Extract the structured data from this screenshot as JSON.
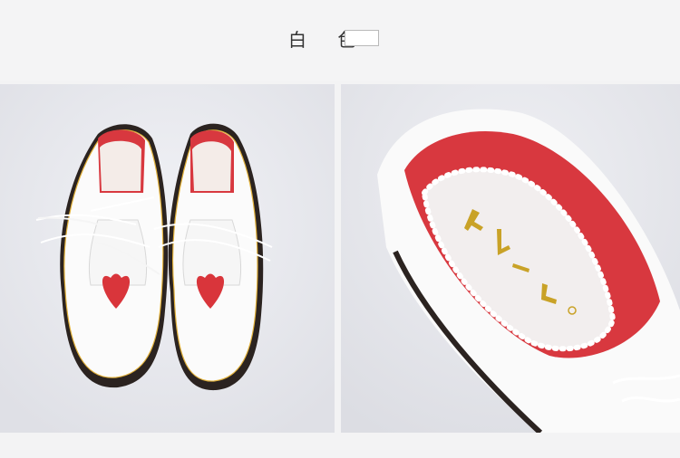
{
  "product": {
    "color_label": "白 色",
    "swatch_color": "#ffffff"
  },
  "photos": [
    {
      "subject": "shoe-pair-top-view",
      "icon": "shoe-pair-image"
    },
    {
      "subject": "shoe-insole-closeup",
      "icon": "insole-image",
      "insole_text": "十九一鹿"
    }
  ],
  "colors": {
    "shoe_white": "#fbfbfb",
    "heart_red": "#d9353b",
    "lining_red": "#d8383f",
    "sole_dark": "#2b2320",
    "stitch_yellow": "#e2b13a",
    "gold_text": "#c9a227"
  }
}
